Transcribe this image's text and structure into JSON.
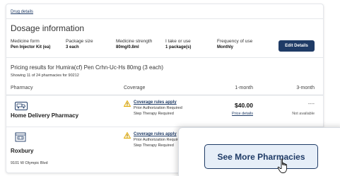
{
  "drug_details_link": "Drug details",
  "dosage": {
    "title": "Dosage information",
    "fields": [
      {
        "label": "Medicine form",
        "value": "Pen Injector Kit (ea)"
      },
      {
        "label": "Package size",
        "value": "3 each"
      },
      {
        "label": "Medicine strength",
        "value": "80mg/0.8ml"
      },
      {
        "label": "I take or use",
        "value": "1 package(s)"
      },
      {
        "label": "Frequency of use",
        "value": "Monthly"
      }
    ],
    "edit_button": "Edit Details"
  },
  "results": {
    "title": "Pricing results for Humira(cf) Pen Crhn-Uc-Hs 80mg (3 each)",
    "subtitle": "Showing 11 of 24 pharmacies for 90212"
  },
  "table": {
    "headers": {
      "pharmacy": "Pharmacy",
      "coverage": "Coverage",
      "one_month": "1-month",
      "three_month": "3-month"
    },
    "rows": [
      {
        "pharmacy": "Home Delivery Pharmacy",
        "icon": "truck-icon",
        "coverage_link": "Coverage rules apply",
        "coverage_lines": [
          "Prior Authorization Required",
          "Step Therapy Required"
        ],
        "price": "$40.00",
        "price_link": "Price details",
        "three_month": "----",
        "three_month_note": "Not available"
      },
      {
        "pharmacy": "Roxbury",
        "address": "9101 W Olympic Blvd",
        "icon": "store-icon",
        "coverage_link": "Coverage rules apply",
        "coverage_lines": [
          "Prior Authorization Require",
          "Step Therapy Required"
        ]
      }
    ]
  },
  "overlay": {
    "button": "See More Pharmacies"
  },
  "colors": {
    "brand": "#1f3b66",
    "warning": "#e0a800",
    "button_bg": "#e6eef8"
  }
}
